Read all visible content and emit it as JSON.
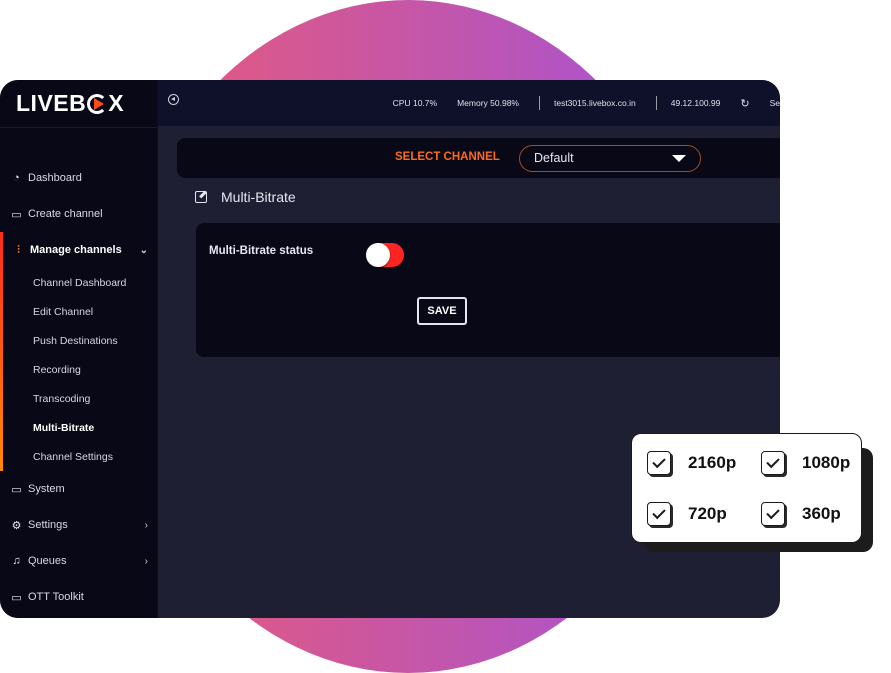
{
  "app": {
    "logo": "LIVEB",
    "logo_tail": "X"
  },
  "topbar": {
    "cpu": "CPU 10.7%",
    "memory": "Memory 50.98%",
    "host": "test3015.livebox.co.in",
    "ip": "49.12.100.99",
    "refresh_label": "Se"
  },
  "sidebar": {
    "items": [
      {
        "label": "Dashboard",
        "icon": "dashboard-gauge-icon"
      },
      {
        "label": "Create channel",
        "icon": "monitor-icon"
      },
      {
        "label": "Manage channels",
        "icon": "sliders-icon",
        "expanded": true
      },
      {
        "label": "System",
        "icon": "monitor-icon"
      },
      {
        "label": "Settings",
        "icon": "gear-icon"
      },
      {
        "label": "Queues",
        "icon": "music-note-icon"
      },
      {
        "label": "OTT Toolkit",
        "icon": "monitor-icon"
      }
    ],
    "sub_items": [
      "Channel Dashboard",
      "Edit Channel",
      "Push Destinations",
      "Recording",
      "Transcoding",
      "Multi-Bitrate",
      "Channel Settings"
    ],
    "active_sub_item": "Multi-Bitrate"
  },
  "channel_select": {
    "label": "SELECT CHANNEL",
    "value": "Default"
  },
  "section": {
    "title": "Multi-Bitrate"
  },
  "card": {
    "status_label": "Multi-Bitrate status",
    "status_enabled": false,
    "save_label": "SAVE"
  },
  "resolutions": [
    {
      "label": "2160p",
      "checked": true
    },
    {
      "label": "1080p",
      "checked": true
    },
    {
      "label": "720p",
      "checked": true
    },
    {
      "label": "360p",
      "checked": true
    }
  ],
  "colors": {
    "accent": "#ff6a1a",
    "toggle": "#ff2424",
    "sidebar_bg": "#080817",
    "content_bg": "#1e1f33"
  }
}
